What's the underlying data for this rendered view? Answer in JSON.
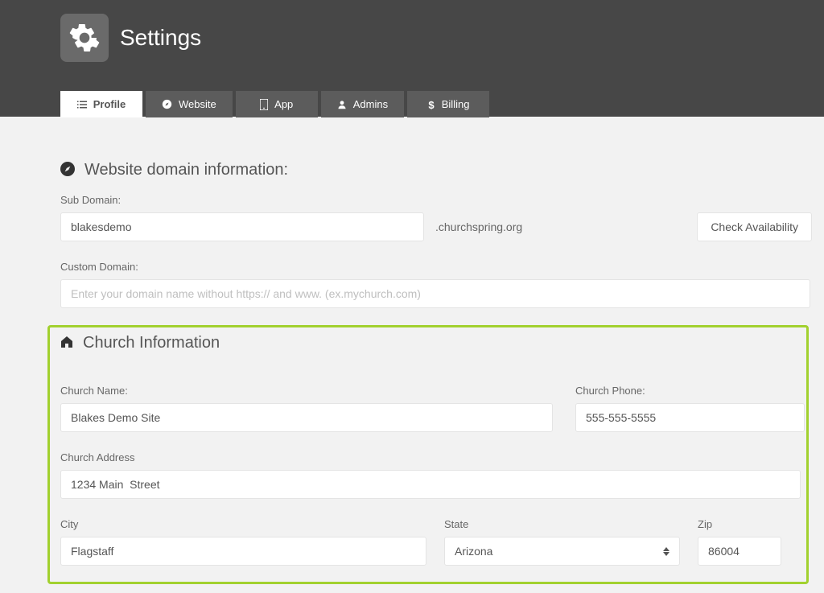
{
  "header": {
    "title": "Settings"
  },
  "tabs": {
    "profile": "Profile",
    "website": "Website",
    "app": "App",
    "admins": "Admins",
    "billing": "Billing"
  },
  "domain_section": {
    "title": "Website domain information:",
    "subdomain_label": "Sub Domain:",
    "subdomain_value": "blakesdemo",
    "suffix": ".churchspring.org",
    "check_button": "Check Availability",
    "custom_label": "Custom Domain:",
    "custom_placeholder": "Enter your domain name without https:// and www. (ex.mychurch.com)"
  },
  "church_section": {
    "title": "Church Information",
    "name_label": "Church Name:",
    "name_value": "Blakes Demo Site",
    "phone_label": "Church Phone:",
    "phone_value": "555-555-5555",
    "address_label": "Church Address",
    "address_value": "1234 Main  Street",
    "city_label": "City",
    "city_value": "Flagstaff",
    "state_label": "State",
    "state_value": "Arizona",
    "zip_label": "Zip",
    "zip_value": "86004"
  }
}
